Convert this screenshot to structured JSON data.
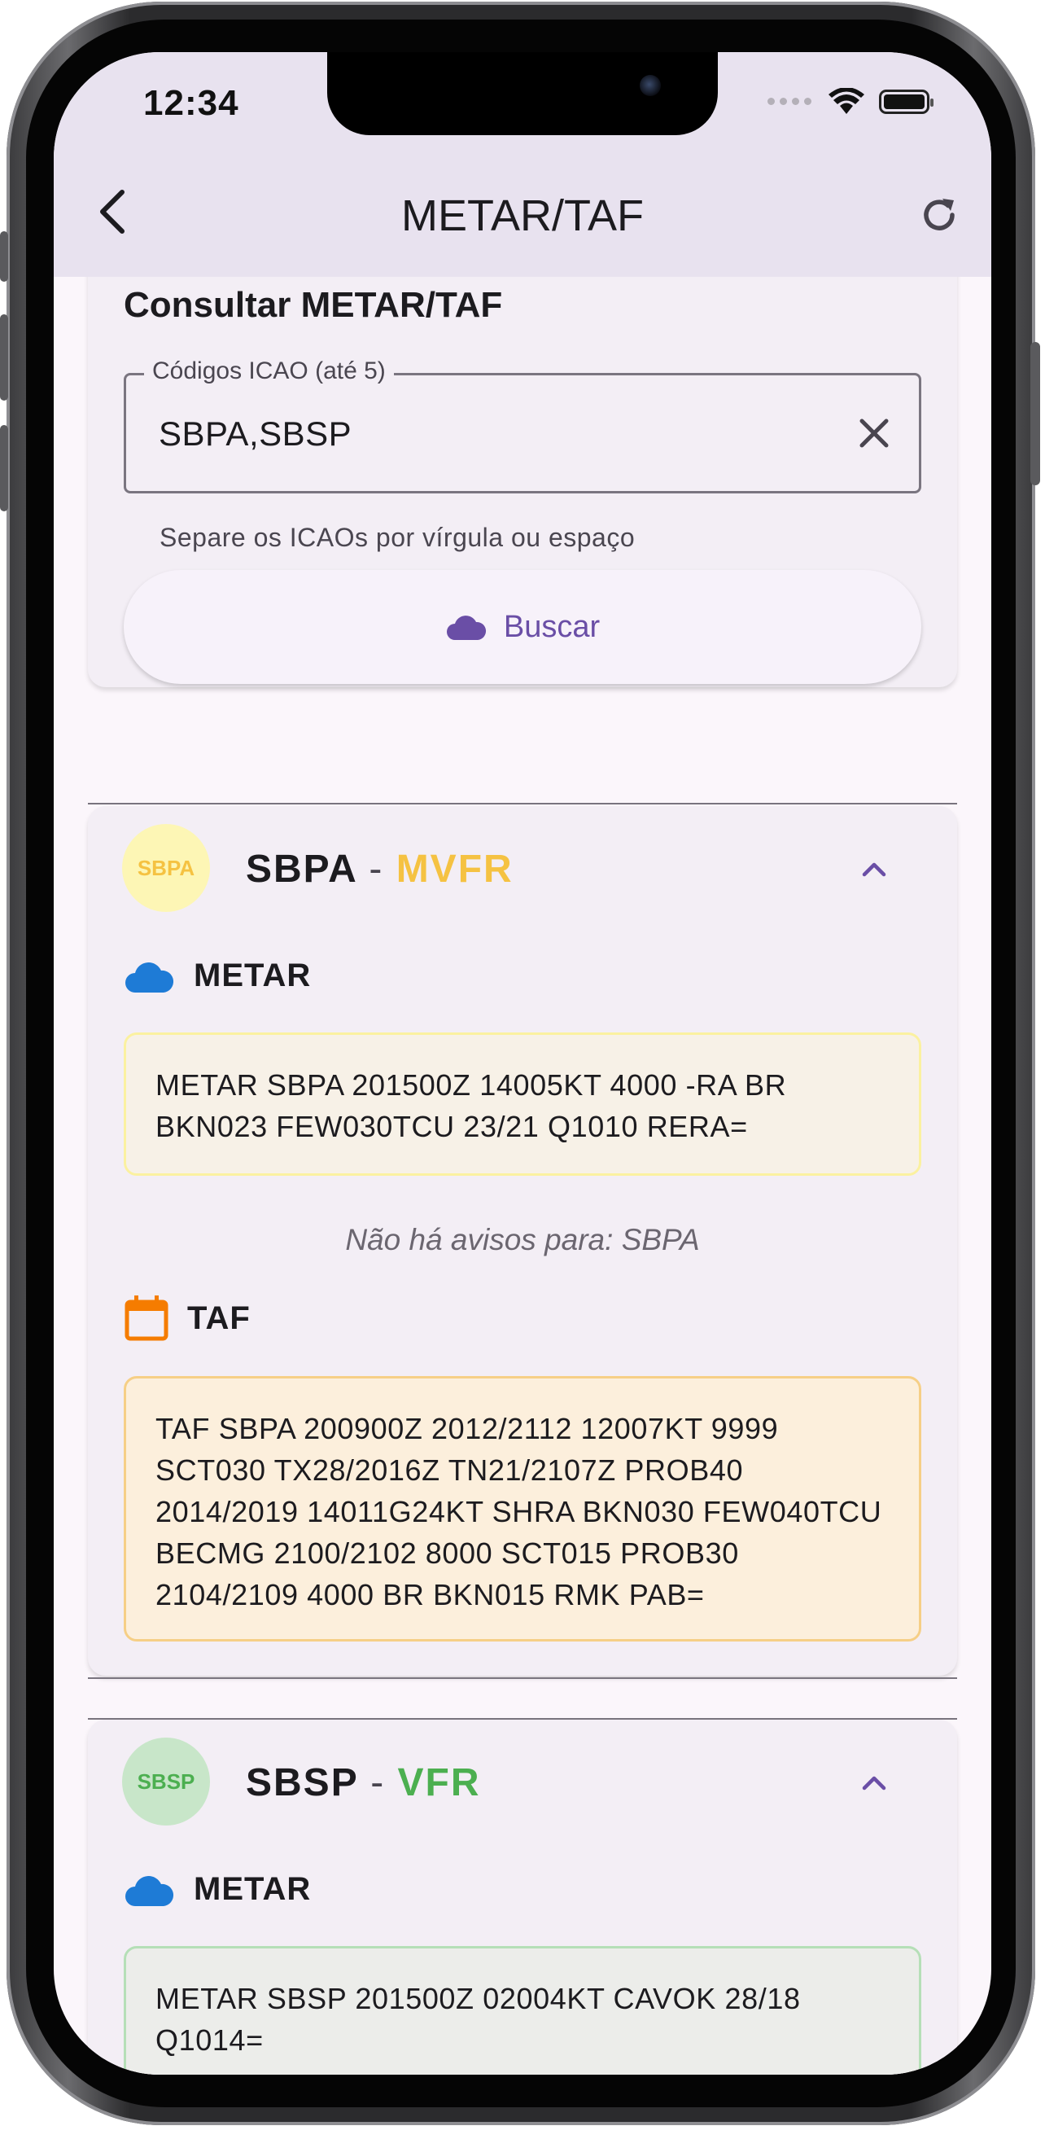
{
  "status_bar": {
    "time": "12:34"
  },
  "app_bar": {
    "title": "METAR/TAF"
  },
  "search": {
    "title": "Consultar METAR/TAF",
    "field_label": "Códigos ICAO (até 5)",
    "field_value": "SBPA,SBSP",
    "helper": "Separe os ICAOs por vírgula ou espaço",
    "button_label": "Buscar"
  },
  "stations": [
    {
      "code": "SBPA",
      "avatar_text": "SBPA",
      "separator": "-",
      "category": "MVFR",
      "category_color": "#f5c242",
      "avatar_bg": "#fdf6b5",
      "metar_label": "METAR",
      "metar_text": "METAR SBPA 201500Z 14005KT 4000 -RA BR BKN023 FEW030TCU 23/21 Q1010 RERA=",
      "no_warnings": "Não há avisos para: SBPA",
      "taf_label": "TAF",
      "taf_text": "TAF SBPA 200900Z 2012/2112 12007KT 9999 SCT030 TX28/2016Z TN21/2107Z PROB40 2014/2019 14011G24KT SHRA BKN030 FEW040TCU BECMG 2100/2102 8000 SCT015 PROB30 2104/2109 4000 BR BKN015 RMK PAB="
    },
    {
      "code": "SBSP",
      "avatar_text": "SBSP",
      "separator": "-",
      "category": "VFR",
      "category_color": "#4caf50",
      "avatar_bg": "#c8e6c9",
      "metar_label": "METAR",
      "metar_text": "METAR SBSP 201500Z 02004KT CAVOK 28/18 Q1014="
    }
  ],
  "icons": {
    "back": "chevron-left-icon",
    "refresh": "refresh-icon",
    "clear": "close-icon",
    "search": "cloud-icon",
    "metar": "cloud-icon",
    "taf": "calendar-icon",
    "collapse": "chevron-up-icon"
  }
}
